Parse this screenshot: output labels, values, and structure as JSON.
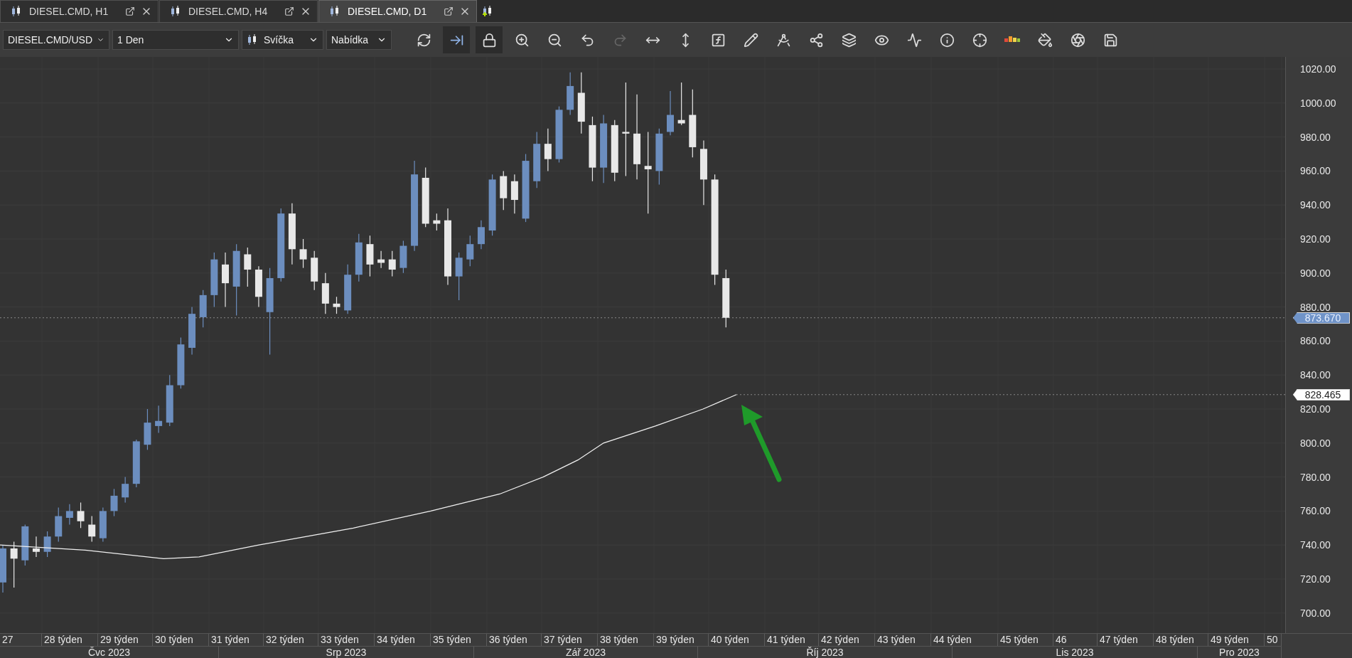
{
  "tabs": [
    {
      "label": "DIESEL.CMD, H1",
      "selected": false
    },
    {
      "label": "DIESEL.CMD, H4",
      "selected": false
    },
    {
      "label": "DIESEL.CMD, D1",
      "selected": true
    }
  ],
  "toolbar": {
    "selects": [
      {
        "value": "DIESEL.CMD/USD",
        "kind": "plain"
      },
      {
        "value": "1 Den",
        "kind": "plain"
      },
      {
        "value": "Svíčka",
        "kind": "candle"
      },
      {
        "value": "Nabídka",
        "kind": "plain"
      }
    ],
    "tools": [
      {
        "pressed": false,
        "disabled": false
      },
      {
        "pressed": true,
        "disabled": false
      },
      {
        "pressed": true,
        "disabled": false
      },
      {
        "pressed": false,
        "disabled": false
      },
      {
        "pressed": false,
        "disabled": false
      },
      {
        "pressed": false,
        "disabled": false
      },
      {
        "pressed": false,
        "disabled": true
      },
      {
        "pressed": false,
        "disabled": false
      },
      {
        "pressed": false,
        "disabled": false
      },
      {
        "pressed": false,
        "disabled": false
      },
      {
        "pressed": false,
        "disabled": false
      },
      {
        "pressed": false,
        "disabled": false
      },
      {
        "pressed": false,
        "disabled": false
      },
      {
        "pressed": false,
        "disabled": false
      },
      {
        "pressed": false,
        "disabled": false
      },
      {
        "pressed": false,
        "disabled": false
      },
      {
        "pressed": false,
        "disabled": false
      },
      {
        "pressed": false,
        "disabled": false
      },
      {
        "pressed": false,
        "disabled": false
      },
      {
        "pressed": false,
        "disabled": false
      },
      {
        "pressed": false,
        "disabled": false
      },
      {
        "pressed": false,
        "disabled": false
      }
    ]
  },
  "chart": {
    "y_axis_labels": [
      "1020.00",
      "1000.00",
      "980.00",
      "960.00",
      "940.00",
      "920.00",
      "900.00",
      "880.00",
      "860.00",
      "840.00",
      "820.00",
      "800.00",
      "780.00",
      "760.00",
      "740.00",
      "720.00",
      "700.00"
    ],
    "price_badges": [
      {
        "value": "873.670",
        "kind": "bid"
      },
      {
        "value": "828.465",
        "kind": "indicator"
      }
    ],
    "weeks": [
      "27",
      "28 týden",
      "29 týden",
      "30 týden",
      "31 týden",
      "32 týden",
      "33 týden",
      "34 týden",
      "35 týden",
      "36 týden",
      "37 týden",
      "38 týden",
      "39 týden",
      "40 týden",
      "41 týden",
      "42 týden",
      "43 týden",
      "44 týden",
      "45 týden",
      "46",
      "47 týden",
      "48 týden",
      "49 týden",
      "50"
    ],
    "months": [
      "Čvc 2023",
      "Srp 2023",
      "Zář 2023",
      "Říj 2023",
      "Lis 2023",
      "Pro 2023"
    ]
  }
}
